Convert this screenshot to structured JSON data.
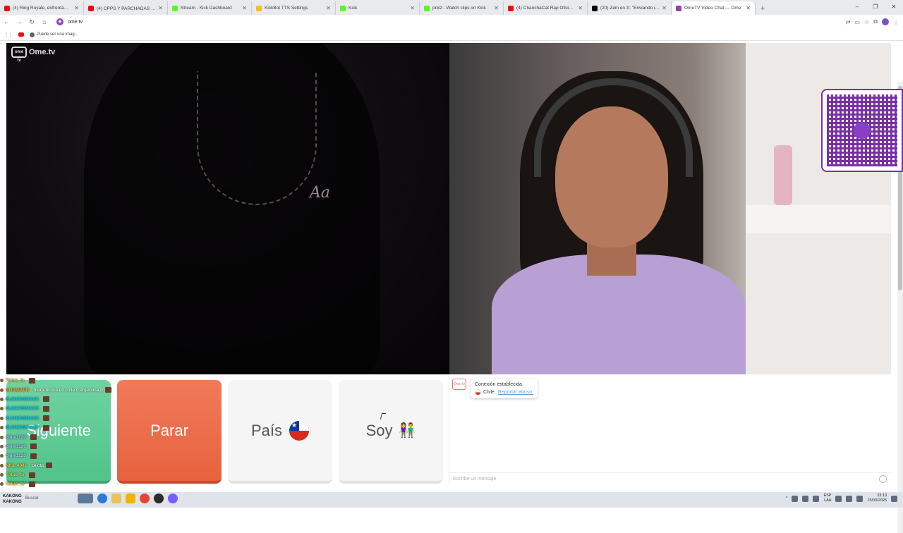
{
  "browser": {
    "tabs": [
      {
        "label": "(4) Ring Royale, enfrentamiento",
        "color": "#ff0000",
        "active": false
      },
      {
        "label": "(4) CPPS Y PARCHADAS 🔥 F",
        "color": "#ff0000",
        "active": false
      },
      {
        "label": "Stream - Kick Dashboard",
        "color": "#53fc18",
        "active": false
      },
      {
        "label": "KickBot TTS Settings",
        "color": "#f4c20d",
        "active": false
      },
      {
        "label": "Kick",
        "color": "#53fc18",
        "active": false
      },
      {
        "label": "pnkz - Watch clips on Kick",
        "color": "#53fc18",
        "active": false
      },
      {
        "label": "(4) ChanchaCat Rap Oficial - Yo",
        "color": "#ff0000",
        "active": false
      },
      {
        "label": "(20) Zein en X: \"Enviando invita",
        "color": "#000000",
        "active": false
      },
      {
        "label": "OmeTV Video Chat — Ome",
        "color": "#8e44ad",
        "active": true
      }
    ],
    "new_tab": "+",
    "window_controls": [
      "–",
      "❐",
      "✕"
    ],
    "url": "ome.tv",
    "bookmark_label": "Puede ser una imag..."
  },
  "video": {
    "logo_text": "Ome.tv",
    "logo_tv": "ome tv"
  },
  "controls": {
    "next_label": "Siguiente",
    "stop_label": "Parar",
    "country_label": "País",
    "gender_label": "Soy",
    "gender_icon": "👫"
  },
  "chat": {
    "system_icon_text": "Ome tv",
    "connection_text": "Conexión establecida.",
    "country_text": "Chile.",
    "report_link": "Reportar abuso.",
    "input_placeholder": "Escribe un mensaje"
  },
  "stream_overlay": [
    {
      "user": "Totue_tv",
      "color": "#f5c542",
      "message": ""
    },
    {
      "user": "CHAMAPR",
      "color": "#ff9f1c",
      "message": ": mura busca en chile o argentina p"
    },
    {
      "user": "ELMAROMAXX",
      "color": "#00d4ff",
      "message": ""
    },
    {
      "user": "ELMAROMAXX",
      "color": "#00d4ff",
      "message": ""
    },
    {
      "user": "ELMAROMAXX",
      "color": "#00d4ff",
      "message": ""
    },
    {
      "user": "ELMAROMAXX",
      "color": "#00d4ff",
      "message": ""
    },
    {
      "user": "billie1120",
      "color": "#a9c7ff",
      "message": ""
    },
    {
      "user": "billie1120",
      "color": "#a9c7ff",
      "message": ""
    },
    {
      "user": "billie1120",
      "color": "#a9c7ff",
      "message": ""
    },
    {
      "user": "Nhs_404z",
      "color": "#f5c542",
      "message": ": cejota"
    },
    {
      "user": "Totue_tv",
      "color": "#f5c542",
      "message": ""
    },
    {
      "user": "Totue_tv",
      "color": "#f5c542",
      "message": ""
    }
  ],
  "taskbar": {
    "start_text_1": "KAKONG",
    "start_text_2": "KAKONG",
    "search_label": "Buscar",
    "lang_1": "ESP",
    "lang_2": "LAA",
    "time": "23:13",
    "date": "15/03/2026"
  }
}
